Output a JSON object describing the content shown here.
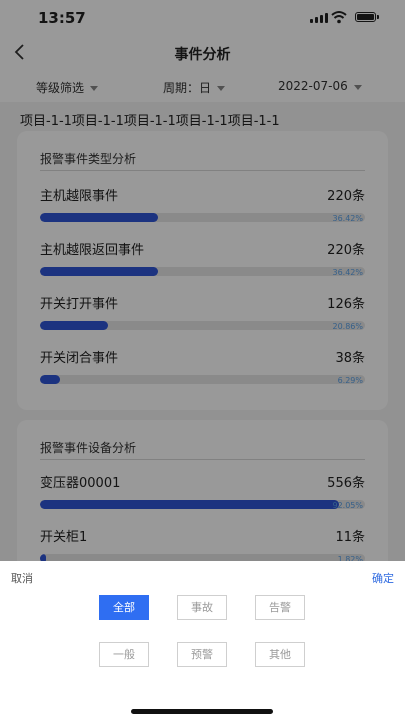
{
  "status": {
    "time": "13:57"
  },
  "nav": {
    "title": "事件分析"
  },
  "filters": {
    "level": "等级筛选",
    "period": "周期：日",
    "date": "2022-07-06"
  },
  "project": "项目-1-1项目-1-1项目-1-1项目-1-1项目-1-1",
  "card1": {
    "title": "报警事件类型分析",
    "rows": [
      {
        "label": "主机越限事件",
        "count": "220条",
        "percent": "36.42%",
        "ratio": 0.3642
      },
      {
        "label": "主机越限返回事件",
        "count": "220条",
        "percent": "36.42%",
        "ratio": 0.3642
      },
      {
        "label": "开关打开事件",
        "count": "126条",
        "percent": "20.86%",
        "ratio": 0.2086
      },
      {
        "label": "开关闭合事件",
        "count": "38条",
        "percent": "6.29%",
        "ratio": 0.0629
      }
    ]
  },
  "card2": {
    "title": "报警事件设备分析",
    "rows": [
      {
        "label": "变压器00001",
        "count": "556条",
        "percent": "92.05%",
        "ratio": 0.9205
      },
      {
        "label": "开关柜1",
        "count": "11条",
        "percent": "1.82%",
        "ratio": 0.0182
      }
    ]
  },
  "sheet": {
    "cancel": "取消",
    "confirm": "确定",
    "options": [
      "全部",
      "事故",
      "告警",
      "一般",
      "预警",
      "其他"
    ],
    "selected": "全部"
  },
  "colors": {
    "accent": "#2f6ef2",
    "bar": "#2f56d6",
    "percent_text": "#5aa0e6"
  }
}
